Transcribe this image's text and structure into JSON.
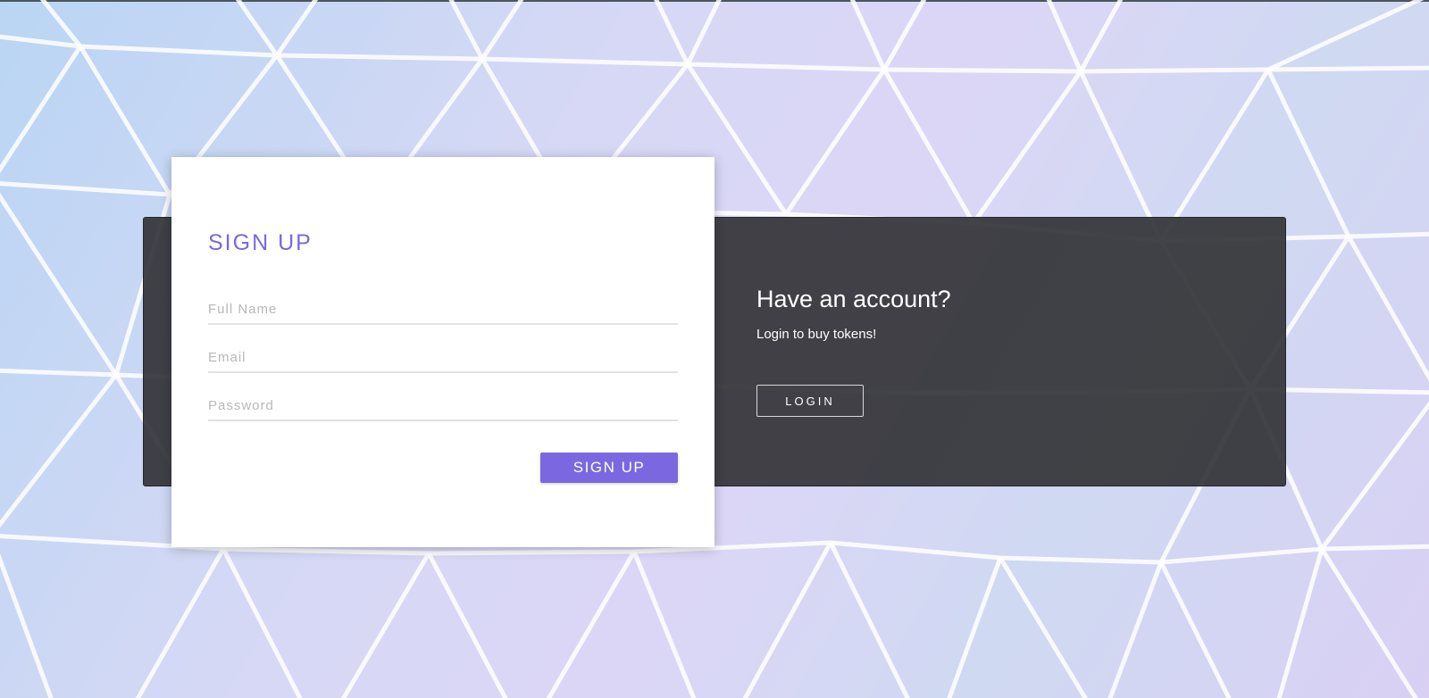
{
  "signup": {
    "title": "SIGN UP",
    "fields": [
      {
        "placeholder": "Full Name",
        "value": ""
      },
      {
        "placeholder": "Email",
        "value": ""
      },
      {
        "placeholder": "Password",
        "value": ""
      }
    ],
    "submit_label": "SIGN UP"
  },
  "login_panel": {
    "title": "Have an account?",
    "subtitle": "Login to buy tokens!",
    "button_label": "LOGIN"
  },
  "colors": {
    "accent": "#7b68e0",
    "panel": "#343538",
    "card": "#ffffff"
  }
}
